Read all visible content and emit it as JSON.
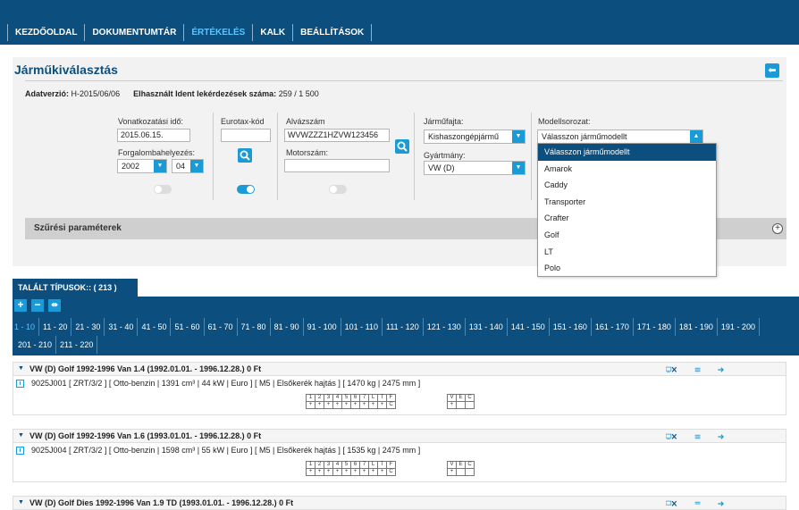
{
  "nav": {
    "tabs": [
      {
        "label": "KEZDŐOLDAL"
      },
      {
        "label": "DOKUMENTUMTÁR"
      },
      {
        "label": "ÉRTÉKELÉS",
        "active": true
      },
      {
        "label": "KALK"
      },
      {
        "label": "BEÁLLÍTÁSOK"
      }
    ]
  },
  "header": {
    "title": "Járműkiválasztás",
    "adat_label": "Adatverzió:",
    "adat_value": "H-2015/06/06",
    "ident_label": "Elhasznált Ident lekérdezések száma:",
    "ident_value": "259 / 1 500"
  },
  "form": {
    "ref_date_label": "Vonatkozatási idő:",
    "ref_date_value": "2015.06.15.",
    "reg_label": "Forgalombahelyezés:",
    "reg_year": "2002",
    "reg_month": "04",
    "eurotax_label": "Eurotax-kód",
    "eurotax_value": "",
    "vin_label": "Alvázszám",
    "vin_value": "WVWZZZ1HZVW123456",
    "engine_label": "Motorszám:",
    "engine_value": "",
    "vehicle_type_label": "Járműfajta:",
    "vehicle_type_value": "Kishaszongépjármű",
    "maker_label": "Gyártmány:",
    "maker_value": "VW (D)",
    "model_label": "Modellsorozat:",
    "model_value": "Válasszon járműmodellt"
  },
  "dropdown": {
    "options": [
      "Válasszon járműmodellt",
      "Amarok",
      "Caddy",
      "Transporter",
      "Crafter",
      "Golf",
      "LT",
      "Polo"
    ]
  },
  "filter": {
    "label": "Szűrési paraméterek"
  },
  "results": {
    "found_label": "TALÁLT TÍPUSOK:: ( 213 )",
    "pages": [
      "1 - 10",
      "11 - 20",
      "21 - 30",
      "31 - 40",
      "41 - 50",
      "51 - 60",
      "61 - 70",
      "71 - 80",
      "81 - 90",
      "91 - 100",
      "101 - 110",
      "111 - 120",
      "121 - 130",
      "131 - 140",
      "141 - 150",
      "151 - 160",
      "161 - 170",
      "171 - 180",
      "181 - 190",
      "191 - 200",
      "201 - 210",
      "211 - 220"
    ],
    "rows": [
      {
        "title": "VW (D) Golf 1992-1996 Van 1.4 (1992.01.01. - 1996.12.28.) 0 Ft",
        "detail": "9025J001 [ ZRT/3/2 ] [ Otto-benzin | 1391 cm³ | 44 kW | Euro ] [ M5 | Elsőkerék hajtás ] [ 1470 kg | 2475 mm ]"
      },
      {
        "title": "VW (D) Golf 1992-1996 Van 1.6 (1993.01.01. - 1996.12.28.) 0 Ft",
        "detail": "9025J004 [ ZRT/3/2 ] [ Otto-benzin | 1598 cm³ | 55 kW | Euro ] [ M5 | Elsőkerék hajtás ] [ 1535 kg | 2475 mm ]"
      },
      {
        "title": "VW (D) Golf Dies 1992-1996 Van 1.9 TD (1993.01.01. - 1996.12.28.) 0 Ft"
      }
    ],
    "grid_top": [
      "1",
      "2",
      "3",
      "4",
      "5",
      "6",
      "7",
      "L",
      "T",
      "F"
    ],
    "grid_bottom": [
      "+",
      "+",
      "+",
      "+",
      "+",
      "+",
      "+",
      "+",
      "+",
      "C"
    ],
    "grid2_top": [
      "V",
      "E",
      "C"
    ],
    "grid2_bottom": [
      "+",
      "",
      ""
    ]
  }
}
